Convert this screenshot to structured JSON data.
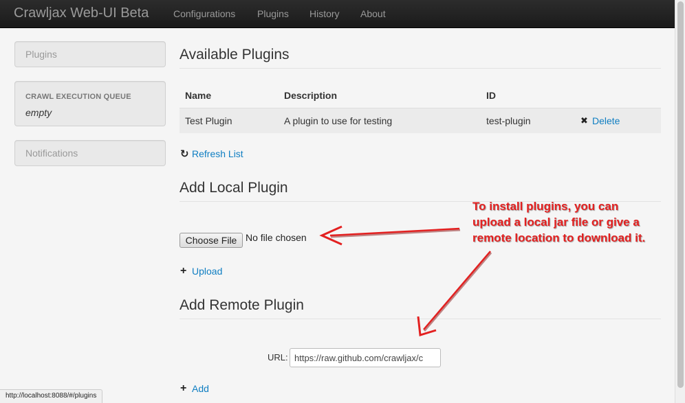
{
  "navbar": {
    "brand": "Crawljax Web-UI Beta",
    "links": [
      "Configurations",
      "Plugins",
      "History",
      "About"
    ]
  },
  "sidebar": {
    "plugins_label": "Plugins",
    "queue_label": "CRAWL EXECUTION QUEUE",
    "queue_value": "empty",
    "notifications_label": "Notifications"
  },
  "available": {
    "title": "Available Plugins",
    "columns": [
      "Name",
      "Description",
      "ID"
    ],
    "rows": [
      {
        "name": "Test Plugin",
        "description": "A plugin to use for testing",
        "id": "test-plugin",
        "action": "Delete"
      }
    ],
    "refresh_label": "Refresh List"
  },
  "local": {
    "title": "Add Local Plugin",
    "choose_file_label": "Choose File",
    "file_status": "No file chosen",
    "upload_label": "Upload"
  },
  "remote": {
    "title": "Add Remote Plugin",
    "url_label": "URL:",
    "url_value": "https://raw.github.com/crawljax/c",
    "add_label": "Add"
  },
  "annotation": {
    "lines": [
      "To install plugins, you can",
      "upload a local jar file or give a",
      "remote location to download it."
    ],
    "color": "#e32020"
  },
  "status_bar": {
    "text": "http://localhost:8088/#/plugins"
  },
  "icons": {
    "delete": "close-icon",
    "refresh": "refresh-icon",
    "add": "plus-icon"
  },
  "colors": {
    "link": "#0f7ec2",
    "navbar": "#1b1b1b"
  }
}
